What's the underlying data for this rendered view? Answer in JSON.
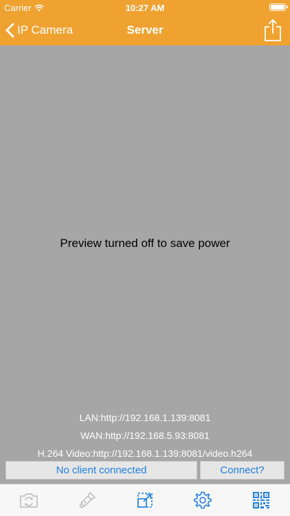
{
  "status_bar": {
    "carrier": "Carrier",
    "time": "10:27 AM"
  },
  "nav": {
    "back_label": "IP Camera",
    "title": "Server"
  },
  "preview": {
    "message": "Preview turned off to save power"
  },
  "server_info": {
    "lan": "LAN:http://192.168.1.139:8081",
    "wan": "WAN:http://192.168.5.93:8081",
    "h264": "H.264 Video:http://192.168.1.139:8081/video.h264"
  },
  "connection": {
    "status": "No client connected",
    "connect_label": "Connect?"
  },
  "tab_bar": {
    "items": [
      {
        "icon": "switch-camera-icon",
        "enabled": false
      },
      {
        "icon": "flashlight-icon",
        "enabled": false
      },
      {
        "icon": "crop-icon",
        "enabled": true
      },
      {
        "icon": "gear-icon",
        "enabled": true
      },
      {
        "icon": "qr-code-icon",
        "enabled": true
      }
    ]
  },
  "colors": {
    "brand_orange": "#f0a231",
    "link_blue": "#1f7ee0",
    "preview_gray": "#a6a6a6",
    "disabled_icon": "#b9b9b9"
  }
}
